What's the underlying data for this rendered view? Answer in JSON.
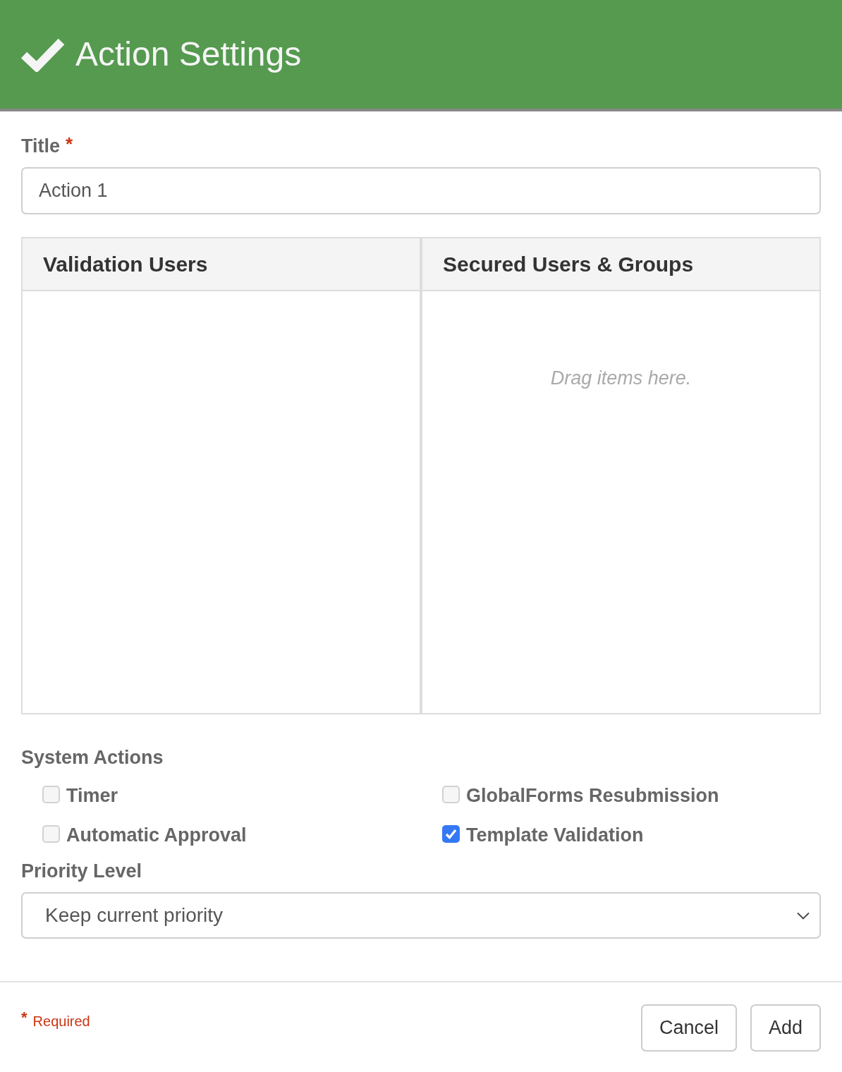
{
  "header": {
    "title": "Action Settings"
  },
  "title_field": {
    "label": "Title",
    "required_mark": "*",
    "value": "Action 1"
  },
  "panels": [
    {
      "title": "Validation Users"
    },
    {
      "title": "Secured Users & Groups",
      "empty_text": "Drag items here."
    }
  ],
  "system_actions": {
    "label": "System Actions",
    "options": [
      {
        "label": "Timer",
        "checked": false
      },
      {
        "label": "GlobalForms Resubmission",
        "checked": false
      },
      {
        "label": "Automatic Approval",
        "checked": false
      },
      {
        "label": "Template Validation",
        "checked": true
      }
    ]
  },
  "priority": {
    "label": "Priority Level",
    "value": "Keep current priority"
  },
  "footer": {
    "required_note": {
      "mark": "*",
      "text": "Required"
    },
    "buttons": [
      {
        "label": "Cancel"
      },
      {
        "label": "Add"
      }
    ]
  }
}
